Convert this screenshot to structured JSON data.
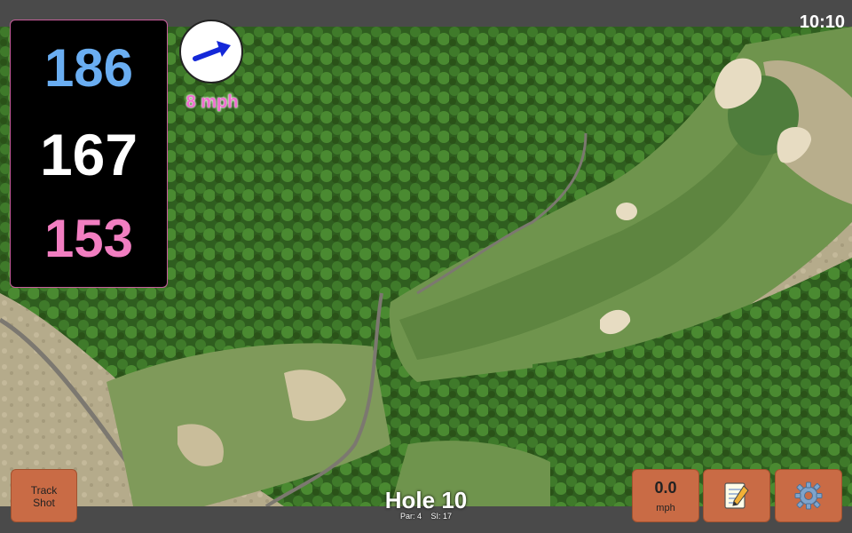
{
  "status": {
    "time": "10:10"
  },
  "distances": {
    "back": "186",
    "center": "167",
    "front": "153"
  },
  "wind": {
    "speed_label": "8 mph",
    "arrow_icon": "wind-direction-arrow-icon"
  },
  "buttons": {
    "track_shot_line1": "Track",
    "track_shot_line2": "Shot",
    "wind_value": "0.0",
    "wind_unit": "mph",
    "notes_icon": "notepad-icon",
    "settings_icon": "gear-icon"
  },
  "hole": {
    "title": "Hole 10",
    "par_label": "Par: 4",
    "si_label": "SI: 17"
  },
  "colors": {
    "back": "#6aaef2",
    "center": "#ffffff",
    "front": "#f27ec1",
    "button": "#c96b45",
    "wind_text": "#f06fd0",
    "arrow": "#1428d8"
  }
}
